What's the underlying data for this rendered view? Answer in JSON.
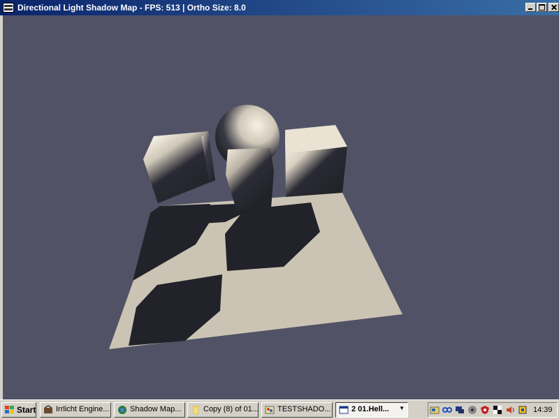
{
  "window": {
    "title": "Directional Light Shadow Map - FPS: 513 | Ortho Size: 8.0"
  },
  "colors": {
    "background": "#525266",
    "floor": "#cbc4b4",
    "shadow": "#22222a",
    "object_dark": "#262630",
    "object_lit": "#f3ede0"
  },
  "taskbar": {
    "start_label": "Start",
    "tasks": [
      {
        "label": "Irrlicht Engine...",
        "icon": "irrlicht-icon",
        "active": false
      },
      {
        "label": "Shadow Map...",
        "icon": "browser-icon",
        "active": false
      },
      {
        "label": "Copy (8) of 01...",
        "icon": "folder-icon",
        "active": false
      },
      {
        "label": "TESTSHADO...",
        "icon": "paint-icon",
        "active": false
      },
      {
        "label": "2 01.Hell...",
        "icon": "window-icon",
        "active": true
      }
    ],
    "tray_icons": [
      "tray-app-icon",
      "tray-link-icon",
      "tray-network-icon",
      "tray-disc-icon",
      "tray-shield-icon",
      "tray-chess-icon",
      "tray-volume-icon",
      "tray-gpu-icon"
    ],
    "clock": "14:39"
  }
}
